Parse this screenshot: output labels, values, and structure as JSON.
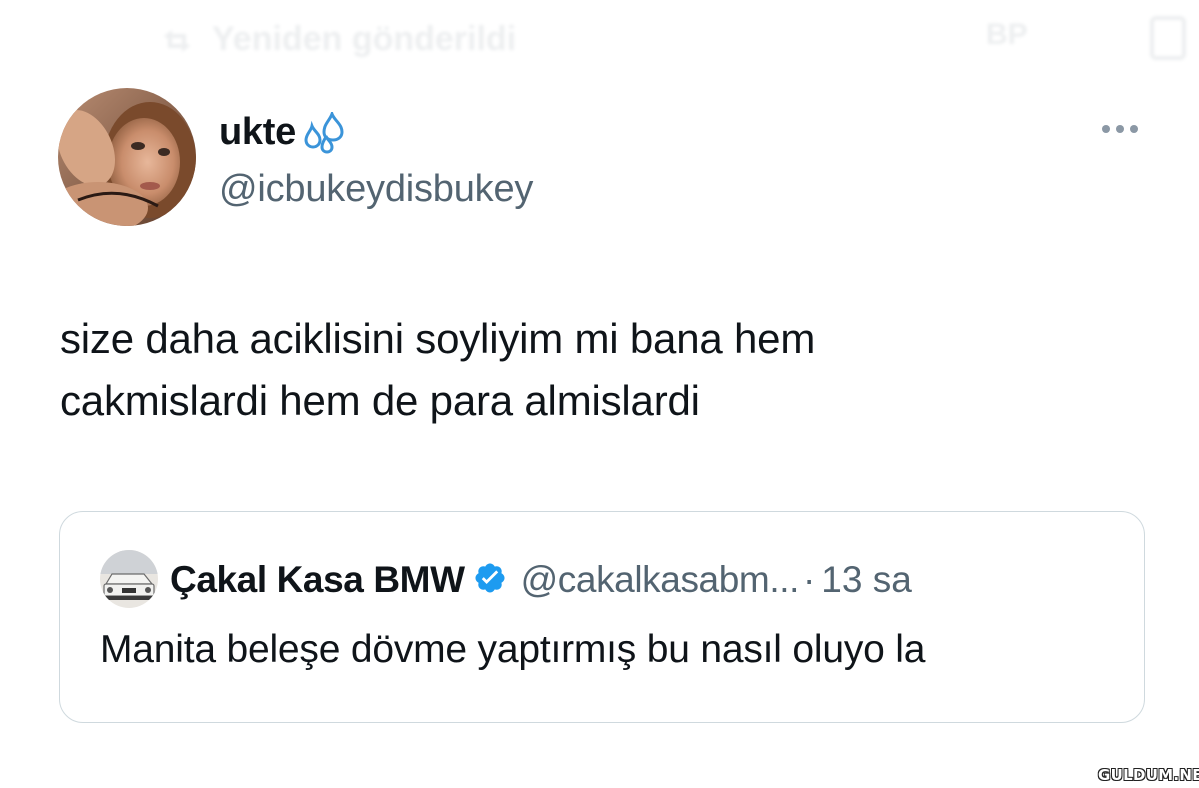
{
  "top_bar": {
    "faded_label": "Yeniden gönderildi",
    "faded_right": "BP"
  },
  "author": {
    "display_name": "ukte",
    "handle": "@icbukeydisbukey",
    "name_emoji_icon": "sweat-droplets-icon"
  },
  "tweet": {
    "lines": [
      "size daha aciklisini soyliyim mi bana hem",
      "cakmislardi hem de para almislardi"
    ]
  },
  "quoted_tweet": {
    "display_name": "Çakal Kasa BMW",
    "handle": "@cakalkasabm...",
    "separator": "·",
    "time": "13 sa",
    "text": "Manita beleşe dövme yaptırmış bu nasıl oluyo la",
    "verified": true
  },
  "watermark": {
    "text": "GULDUM.NET"
  },
  "colors": {
    "text_primary": "#0f1419",
    "text_secondary": "#536471",
    "verified_blue": "#1d9bf0",
    "border": "#cfd9de",
    "droplet": "#3b94d9"
  }
}
